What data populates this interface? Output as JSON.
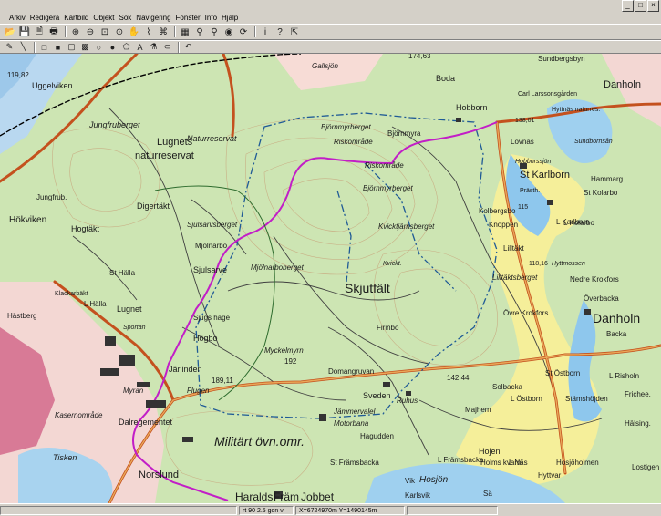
{
  "menu": [
    "Arkiv",
    "Redigera",
    "Kartbild",
    "Objekt",
    "Sök",
    "Navigering",
    "Fönster",
    "Info",
    "Hjälp"
  ],
  "window_buttons": [
    "_",
    "□",
    "×"
  ],
  "toolbar_main": [
    {
      "name": "open-icon",
      "glyph": "📂"
    },
    {
      "name": "save-icon",
      "glyph": "💾"
    },
    {
      "name": "print-preview-icon",
      "glyph": "🗎"
    },
    {
      "name": "print-icon",
      "glyph": "🖶"
    },
    {
      "name": "zoom-in-icon",
      "glyph": "⊕"
    },
    {
      "name": "zoom-out-icon",
      "glyph": "⊖"
    },
    {
      "name": "zoom-box-icon",
      "glyph": "⊡"
    },
    {
      "name": "zoom-full-icon",
      "glyph": "⊙"
    },
    {
      "name": "pan-hand-icon",
      "glyph": "✋"
    },
    {
      "name": "measure-icon",
      "glyph": "⌇"
    },
    {
      "name": "route-icon",
      "glyph": "⌘"
    },
    {
      "name": "layer-icon",
      "glyph": "▦"
    },
    {
      "name": "search-icon",
      "glyph": "⚲"
    },
    {
      "name": "find-icon",
      "glyph": "⚲"
    },
    {
      "name": "gps-icon",
      "glyph": "◉"
    },
    {
      "name": "refresh-icon",
      "glyph": "⟳"
    },
    {
      "name": "info-icon",
      "glyph": "i"
    },
    {
      "name": "help-icon",
      "glyph": "?"
    },
    {
      "name": "help-pointer-icon",
      "glyph": "⇱"
    }
  ],
  "toolbar_draw": [
    {
      "name": "pencil-icon",
      "glyph": "✎"
    },
    {
      "name": "line-icon",
      "glyph": "╲"
    },
    {
      "name": "rectangle-icon",
      "glyph": "□"
    },
    {
      "name": "filled-rectangle-icon",
      "glyph": "■"
    },
    {
      "name": "rounded-rect-icon",
      "glyph": "▢"
    },
    {
      "name": "filled-rounded-rect-icon",
      "glyph": "▩"
    },
    {
      "name": "ellipse-icon",
      "glyph": "○"
    },
    {
      "name": "filled-ellipse-icon",
      "glyph": "●"
    },
    {
      "name": "polygon-icon",
      "glyph": "⬠"
    },
    {
      "name": "text-tool-icon",
      "glyph": "A"
    },
    {
      "name": "eyedropper-icon",
      "glyph": "⚗"
    },
    {
      "name": "lasso-icon",
      "glyph": "⊂"
    },
    {
      "name": "undo-icon",
      "glyph": "↶"
    }
  ],
  "map": {
    "labels": [
      {
        "t": "Gallsjön",
        "cls": "it"
      },
      {
        "t": "174,63"
      },
      {
        "t": "Boda"
      },
      {
        "t": "Sundbergsbyn"
      },
      {
        "t": "Hobborn"
      },
      {
        "t": "Carl Larssonsgården"
      },
      {
        "t": "Hyttnäs naturres."
      },
      {
        "t": "119,82"
      },
      {
        "t": "Uggelviken"
      },
      {
        "t": "Jungfruberget",
        "cls": "it"
      },
      {
        "t": "Naturreservat",
        "cls": "it"
      },
      {
        "t": "Björnmyrberget",
        "cls": "it"
      },
      {
        "t": "Riskområde",
        "cls": "it"
      },
      {
        "t": "Björnmyra"
      },
      {
        "t": "Riskområde",
        "cls": "it"
      },
      {
        "t": "138,01"
      },
      {
        "t": "Lövnäs"
      },
      {
        "t": "Sundbornsån",
        "cls": "it"
      },
      {
        "t": "Danholn"
      },
      {
        "t": "Lugnets"
      },
      {
        "t": "naturreservat"
      },
      {
        "t": "Björnmyrberget",
        "cls": "it"
      },
      {
        "t": "Hobborssjön",
        "cls": "it"
      },
      {
        "t": "St Karlborn"
      },
      {
        "t": "Prästh."
      },
      {
        "t": "Hammarg."
      },
      {
        "t": "St Kolarbo"
      },
      {
        "t": "Jungfrub."
      },
      {
        "t": "Digertäkt"
      },
      {
        "t": "Kolbergsbo"
      },
      {
        "t": "Knoppen"
      },
      {
        "t": "115"
      },
      {
        "t": "L Kolarbo"
      },
      {
        "t": "Hökviken"
      },
      {
        "t": "Hogtäkt"
      },
      {
        "t": "Sjulsarvsberget",
        "cls": "it"
      },
      {
        "t": "Kvicktjärnsberget",
        "cls": "it"
      },
      {
        "t": "L Karlborn"
      },
      {
        "t": "Mjölnarbo"
      },
      {
        "t": "Lilltäkt"
      },
      {
        "t": "Kvickt.",
        "cls": "it"
      },
      {
        "t": "118,16"
      },
      {
        "t": "Hyttmossen",
        "cls": "it"
      },
      {
        "t": "Klackarbäkt"
      },
      {
        "t": "St Hälla"
      },
      {
        "t": "Sjulsarve"
      },
      {
        "t": "Mjölnarboberget",
        "cls": "it"
      },
      {
        "t": "Skjutfält"
      },
      {
        "t": "Lilltäktsberget",
        "cls": "it"
      },
      {
        "t": "Nedre Krokfors"
      },
      {
        "t": "L Hälla"
      },
      {
        "t": "Hästberg"
      },
      {
        "t": "Lugnet"
      },
      {
        "t": "Sportan",
        "cls": "it"
      },
      {
        "t": "Sjugs hage"
      },
      {
        "t": "Övre Krokfors"
      },
      {
        "t": "Överbacka"
      },
      {
        "t": "Danholn"
      },
      {
        "t": "Backa"
      },
      {
        "t": "Högbo"
      },
      {
        "t": "Firinbo"
      },
      {
        "t": "Myckelmyrn",
        "cls": "it"
      },
      {
        "t": "192"
      },
      {
        "t": "Domangruvan"
      },
      {
        "t": "Järlinden"
      },
      {
        "t": "189,11"
      },
      {
        "t": "142,44"
      },
      {
        "t": "St Östborn"
      },
      {
        "t": "L Risholn"
      },
      {
        "t": "Myran",
        "cls": "it"
      },
      {
        "t": "Flugen",
        "cls": "it"
      },
      {
        "t": "Sveden"
      },
      {
        "t": "Ruhus",
        "cls": "it"
      },
      {
        "t": "Solbacka"
      },
      {
        "t": "L Östborn"
      },
      {
        "t": "Frichee."
      },
      {
        "t": "Stämshöjden"
      },
      {
        "t": "Kasernområde",
        "cls": "it"
      },
      {
        "t": "Majhem"
      },
      {
        "t": "Dalregementet"
      },
      {
        "t": "Jämmervalel",
        "cls": "it"
      },
      {
        "t": "Motorbana",
        "cls": "it"
      },
      {
        "t": "Hagudden"
      },
      {
        "t": "Hälsing."
      },
      {
        "t": "Militärt övn.omr.",
        "cls": "it"
      },
      {
        "t": "St Främsbacka"
      },
      {
        "t": "L Främsbacka"
      },
      {
        "t": "Hojen"
      },
      {
        "t": "Holms kvarn"
      },
      {
        "t": "L Näs"
      },
      {
        "t": "Hosjöholmen"
      },
      {
        "t": "Tisken",
        "cls": "it"
      },
      {
        "t": "Norslund"
      },
      {
        "t": "Vik"
      },
      {
        "t": "Hosjön",
        "cls": "it"
      },
      {
        "t": "Hyttvar"
      },
      {
        "t": "Lostigen"
      },
      {
        "t": "Haralds"
      },
      {
        "t": "Främ"
      },
      {
        "t": "Jobbet"
      },
      {
        "t": "Karlsvik"
      },
      {
        "t": "Sä"
      }
    ]
  },
  "status": {
    "mode": "",
    "scale": "rt 90 2.5 gon v",
    "coords": "X=6724970m Y=1490145m",
    "extra": ""
  }
}
